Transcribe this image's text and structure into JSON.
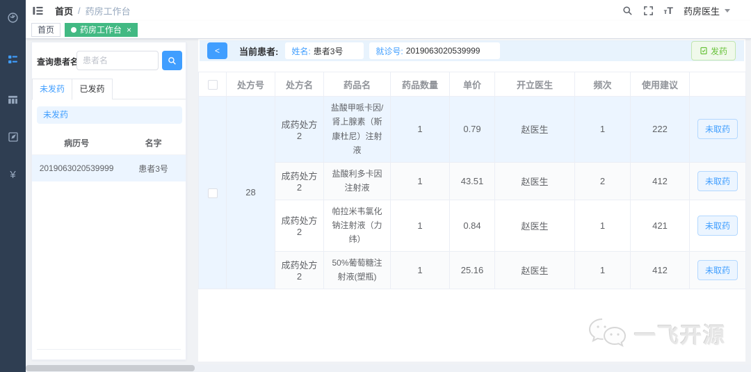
{
  "colors": {
    "accent": "#409eff",
    "tag_green": "#42b983",
    "success": "#67c23a",
    "sidebar_bg": "#2f3e52",
    "row_highlight": "#ecf5ff"
  },
  "sidebar": {
    "icons": [
      "dashboard-icon",
      "menu-tree-icon",
      "table-icon",
      "form-edit-icon",
      "money-icon"
    ],
    "active_index": 1
  },
  "header": {
    "breadcrumb": [
      "首页",
      "药房工作台"
    ],
    "breadcrumb_sep": "/",
    "icons": [
      "search-icon",
      "fullscreen-icon",
      "font-size-icon"
    ],
    "user": "药房医生"
  },
  "tagbar": {
    "tabs": [
      {
        "label": "首页",
        "active": false
      },
      {
        "label": "药房工作台",
        "active": true,
        "closable": true
      }
    ]
  },
  "left": {
    "search_label": "查询患者名:",
    "search_placeholder": "患者名",
    "search_value": "",
    "tabs": [
      "未发药",
      "已发药"
    ],
    "active_tab": "未发药",
    "alert": "未发药",
    "table": {
      "headers": [
        "病历号",
        "名字"
      ],
      "rows": [
        [
          "2019063020539999",
          "患者3号"
        ]
      ]
    }
  },
  "pbar": {
    "back": "<",
    "current": "当前患者:",
    "name_label": "姓名:",
    "name_value": "患者3号",
    "visit_label": "就诊号:",
    "visit_value": "2019063020539999",
    "dispense": "发药"
  },
  "rx": {
    "headers": [
      "",
      "处方号",
      "处方名",
      "药品名",
      "药品数量",
      "单价",
      "开立医生",
      "频次",
      "使用建议",
      ""
    ],
    "presc_no": "28",
    "rows": [
      {
        "pname": "成药处方2",
        "drug": "盐酸甲哌卡因/肾上腺素（斯康杜尼）注射液",
        "qty": "1",
        "price": "0.79",
        "doctor": "赵医生",
        "freq": "1",
        "advice": "222",
        "status": "未取药"
      },
      {
        "pname": "成药处方2",
        "drug": "盐酸利多卡因注射液",
        "qty": "1",
        "price": "43.51",
        "doctor": "赵医生",
        "freq": "2",
        "advice": "412",
        "status": "未取药"
      },
      {
        "pname": "成药处方2",
        "drug": "帕拉米韦氯化钠注射液（力纬）",
        "qty": "1",
        "price": "0.84",
        "doctor": "赵医生",
        "freq": "1",
        "advice": "421",
        "status": "未取药"
      },
      {
        "pname": "成药处方2",
        "drug": "50%葡萄糖注射液(塑瓶)",
        "qty": "1",
        "price": "25.16",
        "doctor": "赵医生",
        "freq": "1",
        "advice": "412",
        "status": "未取药"
      }
    ]
  },
  "watermark": {
    "text": "一飞开源"
  }
}
